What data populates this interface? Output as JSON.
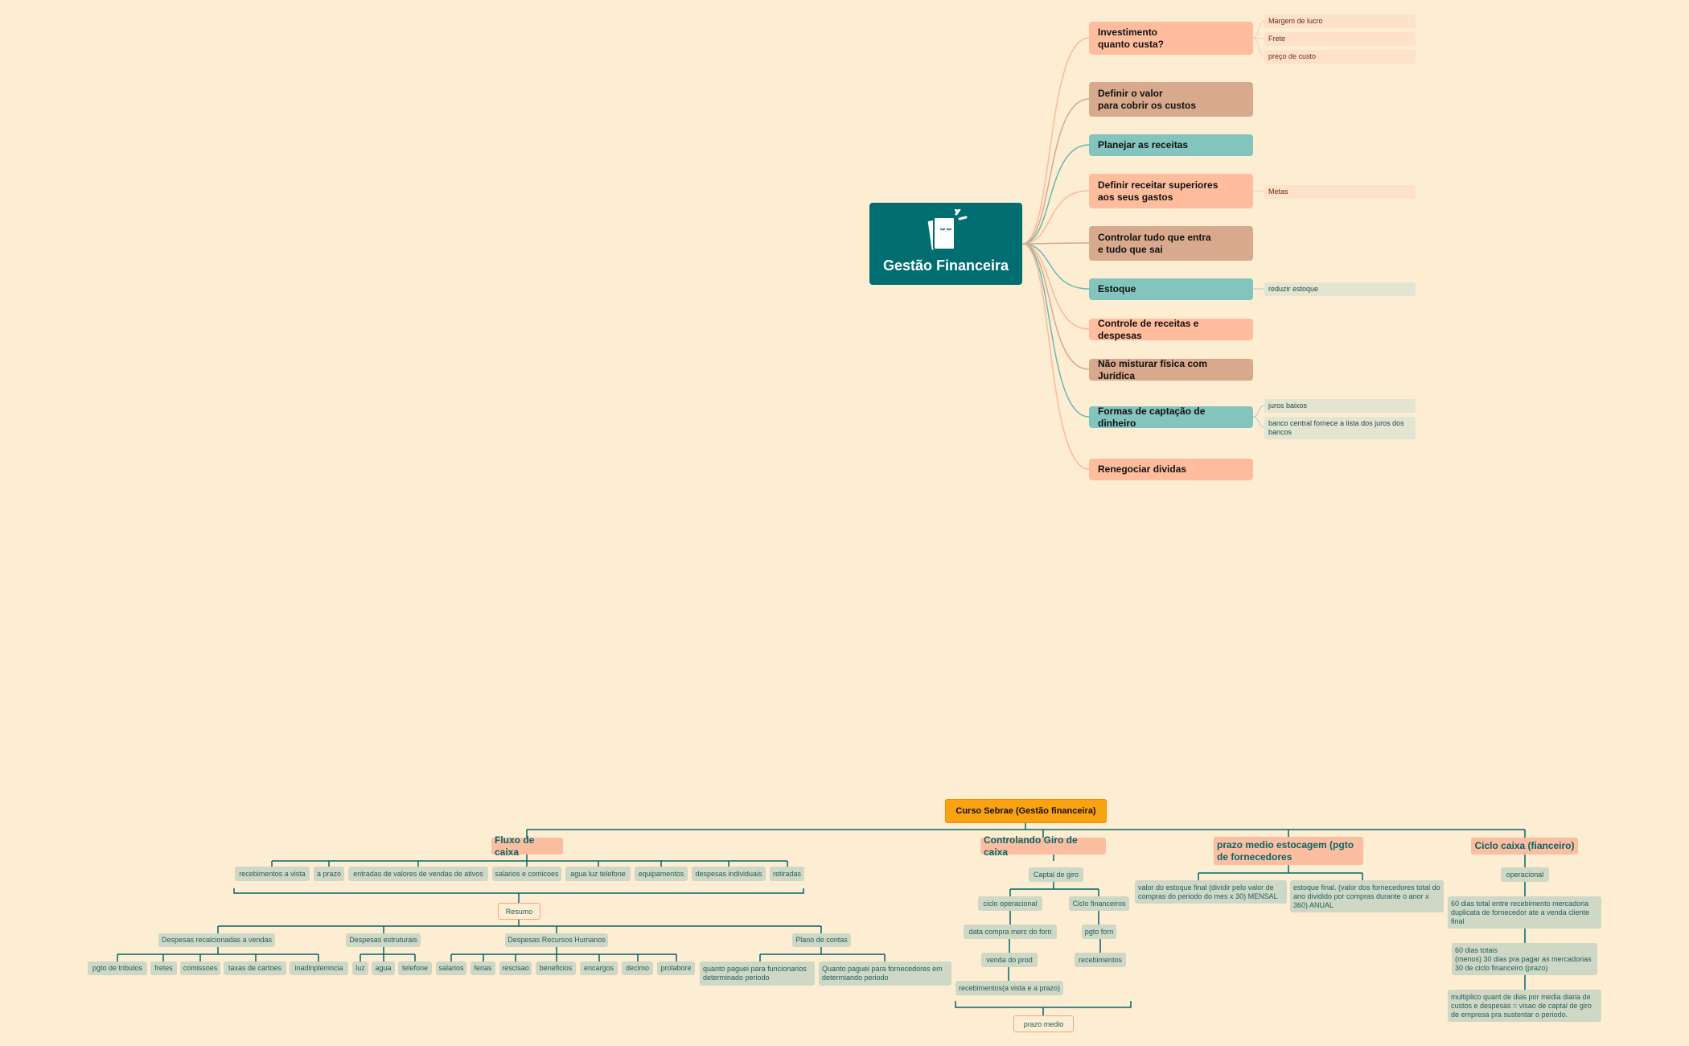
{
  "mindmap": {
    "central": "Gestão Financeira",
    "icon": "notebook-idea-icon",
    "colors": {
      "central": "#006d70",
      "peach": "#ffbd9e",
      "tan": "#d8a98c",
      "teal": "#83c4be",
      "background": "#fdedd3"
    },
    "branches": [
      {
        "label": "Investimento\nquanto custa?",
        "leaves": [
          "Margem de lucro",
          "Frete",
          "preço de custo"
        ]
      },
      {
        "label": "Definir o valor\npara cobrir os custos",
        "leaves": []
      },
      {
        "label": "Planejar as receitas",
        "leaves": []
      },
      {
        "label": "Definir receitar superiores\naos seus gastos",
        "leaves": [
          "Metas"
        ]
      },
      {
        "label": "Controlar tudo que entra\ne tudo que sai",
        "leaves": []
      },
      {
        "label": "Estoque",
        "leaves": [
          "reduzir estoque"
        ]
      },
      {
        "label": "Controle de receitas e despesas",
        "leaves": []
      },
      {
        "label": "Não misturar física com Jurídica",
        "leaves": []
      },
      {
        "label": "Formas de captação de dinheiro",
        "leaves": [
          "juros baixos",
          "banco central fornece a lista dos juros dos bancos"
        ]
      },
      {
        "label": "Renegociar dividas",
        "leaves": []
      }
    ]
  },
  "orgchart": {
    "root": "Curso Sebrae (Gestão financeira)",
    "fluxo": {
      "title": "Fluxo de caixa",
      "items": [
        "recebimentos a vista",
        "a prazo",
        "entradas de valores de vendas de ativos",
        "salarios e comicoes",
        "agua luz telefone",
        "equipamentos",
        "despesas individuais",
        "retiradas"
      ],
      "summary": "Resumo",
      "groups": [
        {
          "label": "Despesas recalcionadas a vendas",
          "items": [
            "pgto de tributos",
            "fretes",
            "comissoes",
            "taxas de cartoes",
            "inadinplemncia"
          ]
        },
        {
          "label": "Despesas estruturais",
          "items": [
            "luz",
            "agua",
            "telefone"
          ]
        },
        {
          "label": "Despesas Recursos Humanos",
          "items": [
            "salarios",
            "ferias",
            "rescisao",
            "beneficios",
            "encargos",
            "decimo",
            "prolabore"
          ]
        },
        {
          "label": "Plano de contas",
          "items": [
            "quanto paguei para funcionarios determinado periodo",
            "Quanto paguei para fornecedores em determiando periodo"
          ]
        }
      ]
    },
    "giro": {
      "title": "Controlando Giro de caixa",
      "capital": "Captal de giro",
      "operacional": {
        "label": "ciclo operacional",
        "items": [
          "data compra merc do forn",
          "venda do prod",
          "recebimentos(a vista e a prazo)"
        ]
      },
      "financeiro": {
        "label": "Ciclo financeiros",
        "items": [
          "pgto forn",
          "recebimentos"
        ]
      },
      "summary": "prazo medio"
    },
    "prazo": {
      "title": "prazo medio  estocagem (pgto de fornecedores",
      "items": [
        "valor do estoque final (dividir pelo valor de compras do periodo do mes x 30) MENSAL",
        "estoque final. (valor dos fornecedores total do ano dividido por compras durante o anor x 360) ANUAL"
      ]
    },
    "ciclo": {
      "title": "Ciclo caixa (fianceiro)",
      "operacional": "operacional",
      "items": [
        "60 dias total entre recebimento mercadoria duplicata de fornecedor ate a venda cliente final",
        "60 dias totais\n(menos) 30 dias pra pagar as mercadorias\n30 de ciclo financeiro (prazo)",
        "multiplico quant de dias por media diaria de custos e despesas = visao de captal de giro de empresa pra sustentar o periodo."
      ]
    }
  }
}
